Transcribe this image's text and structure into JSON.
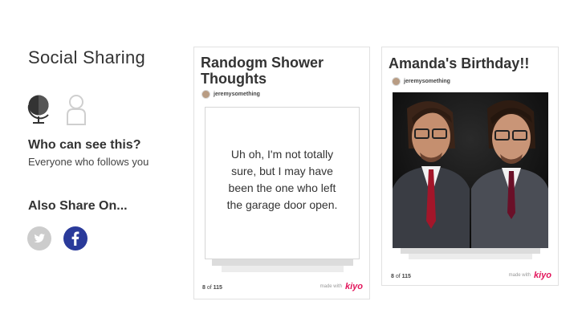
{
  "panel": {
    "title": "Social Sharing",
    "visibility_icons": [
      "globe-icon",
      "person-icon"
    ],
    "who_title": "Who can see this?",
    "who_subtitle": "Everyone who follows you",
    "also_share_title": "Also Share On...",
    "share_networks": [
      "twitter-icon",
      "facebook-icon"
    ]
  },
  "cards": [
    {
      "title_line1": "Randogm Shower",
      "title_line2": "Thoughts",
      "author": "jeremysomething",
      "quote_lines": [
        "Uh oh, I'm not totally",
        "sure, but I may have",
        "been the one who left",
        "the garage door open."
      ],
      "page_current": "8",
      "page_of": "of",
      "page_total": "115",
      "made_with": "made with",
      "brand": "kiyo"
    },
    {
      "title": "Amanda's Birthday!!",
      "author": "jeremysomething",
      "page_current": "8",
      "page_of": "of",
      "page_total": "115",
      "made_with": "made with",
      "brand": "kiyo"
    }
  ],
  "colors": {
    "globe": "#333333",
    "person_outline": "#cccccc",
    "twitter_bg": "#cccccc",
    "facebook_bg": "#2a3a9a",
    "brand_pink": "#e2145a"
  }
}
